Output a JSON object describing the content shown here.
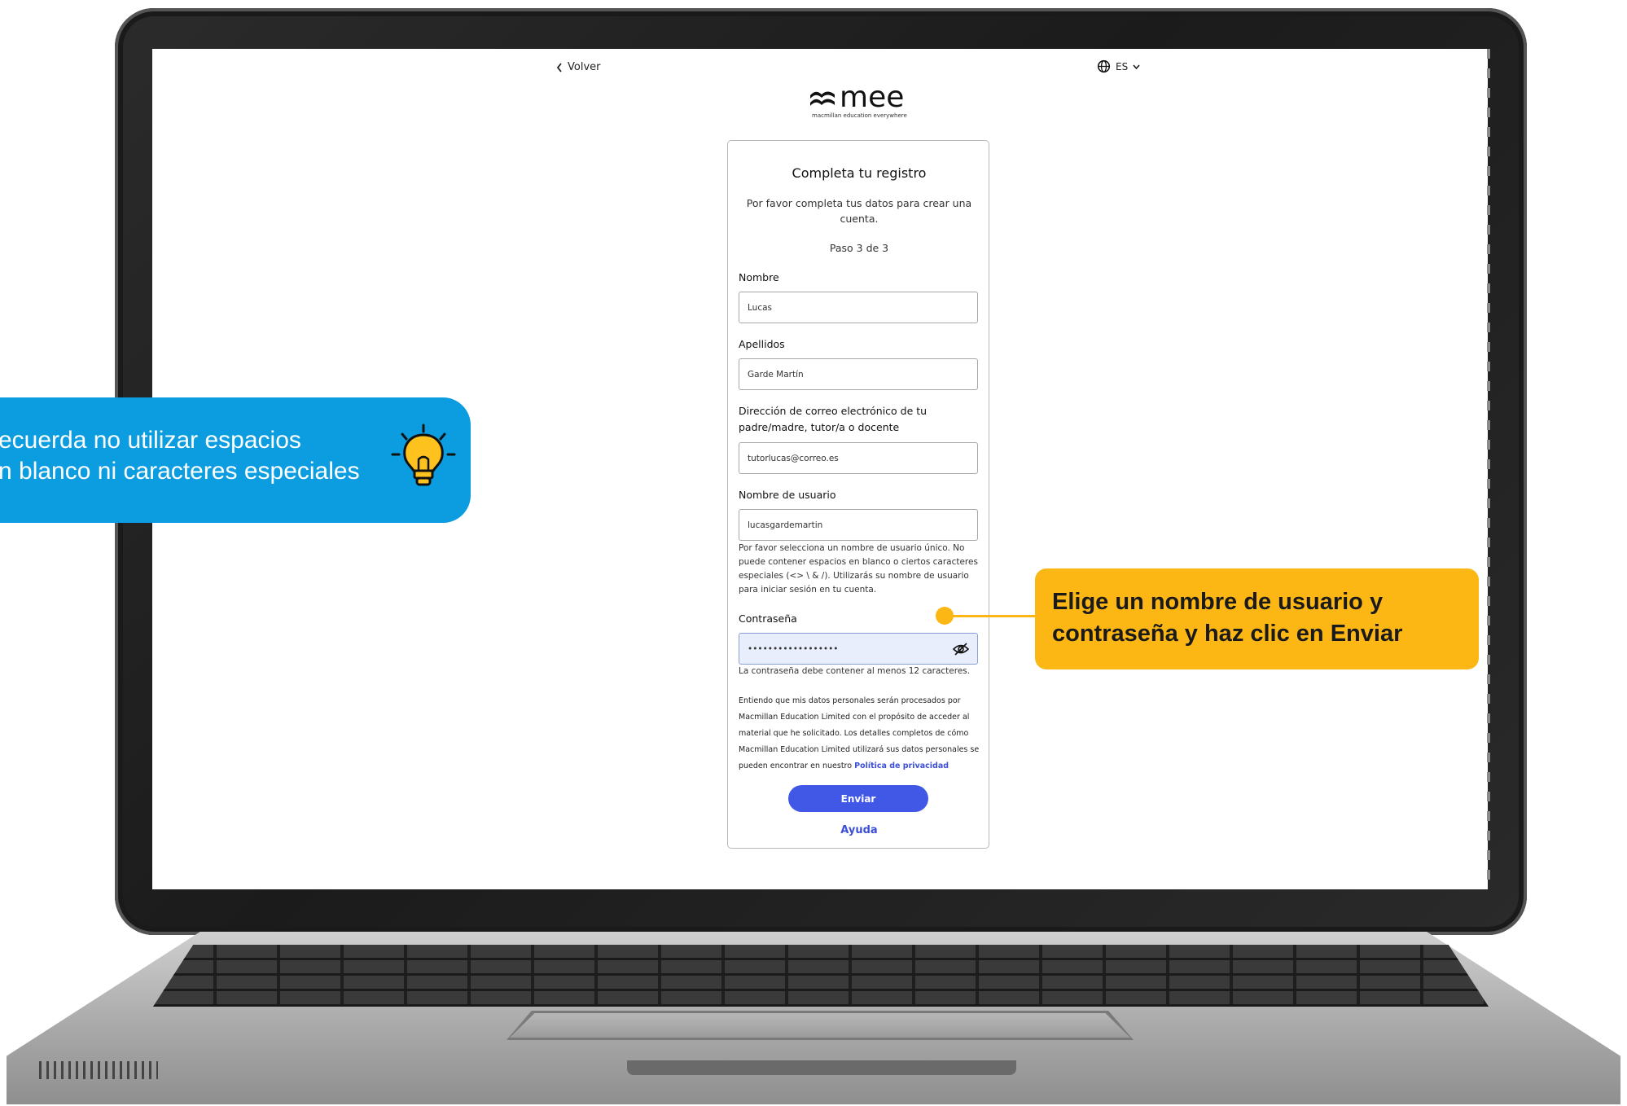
{
  "header": {
    "back_label": "Volver",
    "language_label": "ES",
    "logo_word": "mee",
    "logo_tagline": "macmillan education everywhere"
  },
  "form": {
    "title": "Completa tu registro",
    "subtitle": "Por favor completa tus datos para crear una cuenta.",
    "step": "Paso 3 de 3",
    "fields": {
      "first_name": {
        "label": "Nombre",
        "value": "Lucas"
      },
      "last_name": {
        "label": "Apellidos",
        "value": "Garde Martín"
      },
      "email": {
        "label": "Dirección de correo electrónico de tu padre/madre, tutor/a o docente",
        "value": "tutorlucas@correo.es"
      },
      "username": {
        "label": "Nombre de usuario",
        "value": "lucasgardemartin",
        "help": "Por favor selecciona un nombre de usuario único. No puede contener espacios en blanco o ciertos caracteres especiales (<> \\ & /). Utilizarás su nombre de usuario para iniciar sesión en tu cuenta."
      },
      "password": {
        "label": "Contraseña",
        "value": "••••••••••••••••••",
        "help": "La contraseña debe contener al menos 12 caracteres."
      }
    },
    "legal_text": "Entiendo que mis datos personales serán procesados por Macmillan Education Limited con el propósito de acceder al material que he solicitado. Los detalles completos de cómo Macmillan Education Limited utilizará sus datos personales se pueden encontrar en nuestro",
    "privacy_link": "Política de privacidad",
    "submit_label": "Enviar",
    "help_link": "Ayuda"
  },
  "callouts": {
    "tip": "ecuerda no utilizar espacios\nn blanco ni caracteres especiales",
    "instruction": "Elige un nombre de usuario y contraseña y haz clic en Enviar"
  },
  "colors": {
    "tip_background": "#0b9de0",
    "instruction_background": "#fdb714",
    "primary_button": "#4158e6",
    "link": "#3b4fd8"
  },
  "icons": {
    "back": "chevron-left-icon",
    "language": "globe-icon",
    "language_dropdown": "chevron-down-icon",
    "password_visibility": "eye-off-icon",
    "tip": "lightbulb-icon"
  }
}
